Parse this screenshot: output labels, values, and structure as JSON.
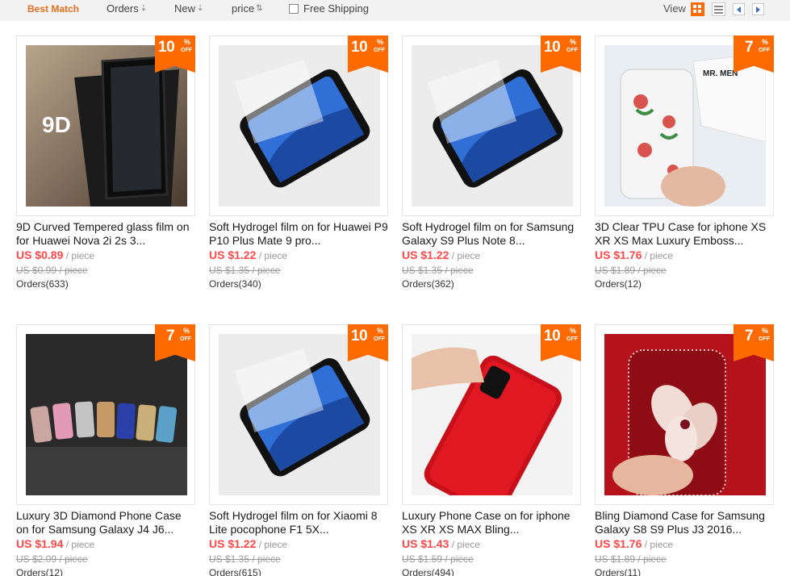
{
  "sortbar": {
    "best_match": "Best Match",
    "orders": "Orders",
    "new": "New",
    "price": "price",
    "free_shipping": "Free Shipping",
    "view_label": "View",
    "active_color": "#e56f20"
  },
  "colors": {
    "accent": "#ff6a00",
    "price": "#ff4747",
    "muted": "#999999"
  },
  "products": [
    {
      "title": "9D Curved Tempered glass film on for Huawei Nova 2i 2s 3...",
      "price": "US $0.89",
      "unit": " / piece",
      "old_price": "US $0.99 / piece",
      "orders": "Orders(633)",
      "discount": "10",
      "pct": "%",
      "off": "OFF",
      "thumb_text": "9D"
    },
    {
      "title": "Soft Hydrogel film on for Huawei P9 P10 Plus Mate 9 pro...",
      "price": "US $1.22",
      "unit": " / piece",
      "old_price": "US $1.35 / piece",
      "orders": "Orders(340)",
      "discount": "10",
      "pct": "%",
      "off": "OFF"
    },
    {
      "title": "Soft Hydrogel film on for Samsung Galaxy S9 Plus Note 8...",
      "price": "US $1.22",
      "unit": " / piece",
      "old_price": "US $1.35 / piece",
      "orders": "Orders(362)",
      "discount": "10",
      "pct": "%",
      "off": "OFF"
    },
    {
      "title": "3D Clear TPU Case for iphone XS XR XS Max Luxury Emboss...",
      "price": "US $1.76",
      "unit": " / piece",
      "old_price": "US $1.89 / piece",
      "orders": "Orders(12)",
      "discount": "7",
      "pct": "%",
      "off": "OFF",
      "thumb_text": "MR. MEN"
    },
    {
      "title": "Luxury 3D Diamond Phone Case on for Samsung Galaxy J4 J6...",
      "price": "US $1.94",
      "unit": " / piece",
      "old_price": "US $2.09 / piece",
      "orders": "Orders(12)",
      "discount": "7",
      "pct": "%",
      "off": "OFF"
    },
    {
      "title": "Soft Hydrogel film on for Xiaomi 8 Lite pocophone F1 5X...",
      "price": "US $1.22",
      "unit": " / piece",
      "old_price": "US $1.35 / piece",
      "orders": "Orders(615)",
      "discount": "10",
      "pct": "%",
      "off": "OFF"
    },
    {
      "title": "Luxury Phone Case on for iphone XS XR XS MAX Bling...",
      "price": "US $1.43",
      "unit": " / piece",
      "old_price": "US $1.59 / piece",
      "orders": "Orders(494)",
      "discount": "10",
      "pct": "%",
      "off": "OFF"
    },
    {
      "title": "Bling Diamond Case for Samsung Galaxy S8 S9 Plus J3 2016...",
      "price": "US $1.76",
      "unit": " / piece",
      "old_price": "US $1.89 / piece",
      "orders": "Orders(11)",
      "discount": "7",
      "pct": "%",
      "off": "OFF"
    }
  ]
}
